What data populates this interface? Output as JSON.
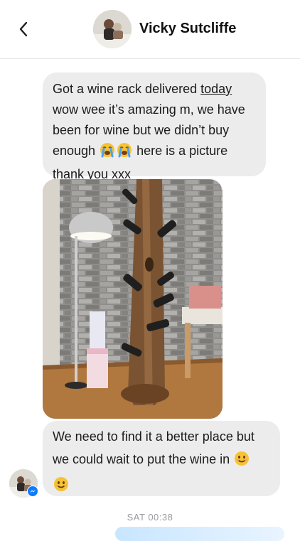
{
  "header": {
    "contact_name": "Vicky Sutcliffe",
    "back_icon": "chevron-left-icon"
  },
  "messages": [
    {
      "lines": [
        [
          "Got a wine rack delivered ",
          "today"
        ],
        [
          "wow wee it’s amazing m, we have"
        ],
        [
          "been for wine but we didn’t buy"
        ],
        [
          "enough",
          " here is a picture"
        ],
        [
          "thank you xxx"
        ]
      ],
      "emojis": [
        "crying-face-icon",
        "crying-face-icon"
      ]
    },
    {
      "type": "photo",
      "description_icon": "wine-rack-photo"
    },
    {
      "lines": [
        [
          "We need to find it a better place but"
        ],
        [
          "we could wait to put the wine in"
        ]
      ],
      "emojis": [
        "smiling-face-icon",
        "smiling-face-icon"
      ]
    }
  ],
  "timestamp": "SAT 00:38",
  "colors": {
    "incoming_bubble": "#ececec",
    "badge_blue": "#0a7cff"
  }
}
